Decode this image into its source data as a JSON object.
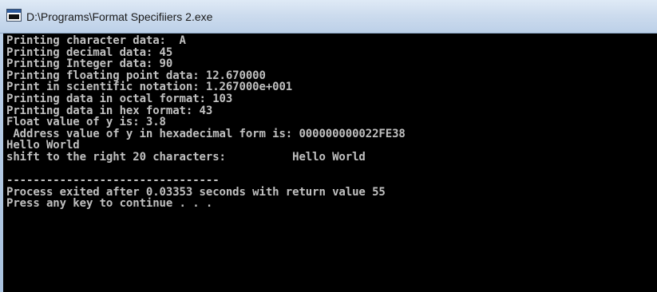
{
  "window": {
    "title": "D:\\Programs\\Format Specifiiers 2.exe"
  },
  "console": {
    "lines": [
      "Printing character data:  A",
      "Printing decimal data: 45",
      "Printing Integer data: 90",
      "Printing floating point data: 12.670000",
      "Print in scientific notation: 1.267000e+001",
      "Printing data in octal format: 103",
      "Printing data in hex format: 43",
      "Float value of y is: 3.8",
      " Address value of y in hexadecimal form is: 000000000022FE38",
      "Hello World",
      "shift to the right 20 characters:          Hello World",
      "",
      "--------------------------------",
      "Process exited after 0.03353 seconds with return value 55",
      "Press any key to continue . . ."
    ]
  },
  "colors": {
    "console_background": "#000000",
    "console_text": "#c0c0c0",
    "titlebar": "#cddcee"
  },
  "icons": {
    "window_icon": "console-window-icon"
  }
}
